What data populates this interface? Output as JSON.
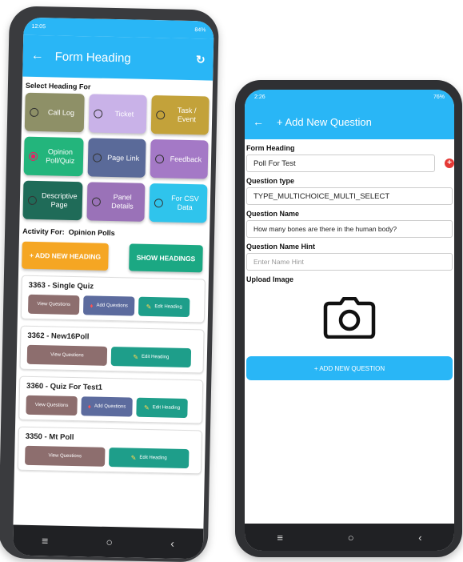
{
  "phone1": {
    "status": {
      "time": "12:05",
      "right": "84%"
    },
    "appbar": {
      "back_icon": "arrow-left-icon",
      "title": "Form Heading",
      "refresh_icon": "refresh-icon"
    },
    "select_heading_label": "Select Heading For",
    "tiles": [
      {
        "label": "Call Log",
        "color": "#8e9067",
        "selected": false
      },
      {
        "label": "Ticket",
        "color": "#c9b2e8",
        "selected": false
      },
      {
        "label": "Task / Event",
        "color": "#c3a23a",
        "selected": false
      },
      {
        "label": "Opinion Poll/Quiz",
        "color": "#23b57c",
        "selected": true
      },
      {
        "label": "Page Link",
        "color": "#5a6a99",
        "selected": false
      },
      {
        "label": "Feedback",
        "color": "#a479c6",
        "selected": false
      },
      {
        "label": "Descriptive Page",
        "color": "#1f6b58",
        "selected": false
      },
      {
        "label": "Panel Details",
        "color": "#9a72b8",
        "selected": false
      },
      {
        "label": "For CSV Data",
        "color": "#2fc4ec",
        "selected": false
      }
    ],
    "activity_for": {
      "label": "Activity For:",
      "value": "Opinion Polls"
    },
    "add_new_heading": "+ ADD NEW HEADING",
    "show_headings": "SHOW HEADINGS",
    "cards": [
      {
        "title": "3363 - Single Quiz",
        "view": "View Questions",
        "add": "Add Questions",
        "edit": "Edit Heading",
        "has_add": true
      },
      {
        "title": "3362 - New16Poll",
        "view": "View Questions",
        "edit": "Edit Heading",
        "has_add": false
      },
      {
        "title": "3360 - Quiz For Test1",
        "view": "View Questions",
        "add": "Add Questions",
        "edit": "Edit Heading",
        "has_add": true
      },
      {
        "title": "3350 - Mt Poll",
        "view": "View Questions",
        "edit": "Edit Heading",
        "has_add": false
      }
    ],
    "nav": {
      "menu": "≡",
      "home": "○",
      "back": "‹"
    }
  },
  "phone2": {
    "status": {
      "time": "2:26",
      "right": "76%"
    },
    "appbar": {
      "back_icon": "arrow-left-icon",
      "title": "+ Add New Question"
    },
    "form_heading_label": "Form Heading",
    "form_heading_value": "Poll For Test",
    "question_type_label": "Question type",
    "question_type_value": "TYPE_MULTICHOICE_MULTI_SELECT",
    "question_name_label": "Question Name",
    "question_name_value": "How many bones are there in the human body?",
    "question_hint_label": "Question Name Hint",
    "question_hint_placeholder": "Enter Name Hint",
    "upload_image_label": "Upload Image",
    "add_button": "+ ADD NEW QUESTION",
    "nav": {
      "menu": "≡",
      "home": "○",
      "back": "‹"
    }
  }
}
